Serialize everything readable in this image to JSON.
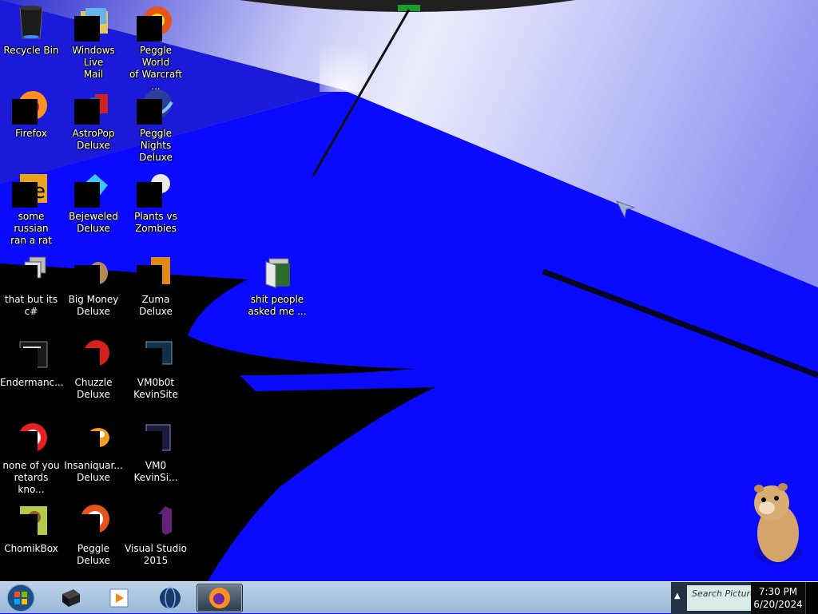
{
  "desktop": {
    "icons": [
      {
        "label": "Recycle Bin",
        "icon": "recycle-bin-icon"
      },
      {
        "label": "Windows Live\nMail",
        "icon": "mail-icon"
      },
      {
        "label": "Peggle World\nof Warcraft ...",
        "icon": "peggle-wow-icon"
      },
      {
        "label": "Firefox",
        "icon": "firefox-icon"
      },
      {
        "label": "AstroPop\nDeluxe",
        "icon": "astropop-icon"
      },
      {
        "label": "Peggle Nights\nDeluxe",
        "icon": "peggle-nights-icon"
      },
      {
        "label": "some russian\nran a rat",
        "icon": "app-icon"
      },
      {
        "label": "Bejeweled\nDeluxe",
        "icon": "bejeweled-icon"
      },
      {
        "label": "Plants vs\nZombies",
        "icon": "plants-vs-zombies-icon"
      },
      {
        "label": "that but its c#",
        "icon": "app-icon"
      },
      {
        "label": "Big Money\nDeluxe",
        "icon": "big-money-icon"
      },
      {
        "label": "Zuma Deluxe",
        "icon": "zuma-icon"
      },
      {
        "label": "Endermanc...",
        "icon": "terminal-icon"
      },
      {
        "label": "Chuzzle\nDeluxe",
        "icon": "chuzzle-icon"
      },
      {
        "label": "VM0b0t\nKevinSite",
        "icon": "vm-icon"
      },
      {
        "label": "none of you\nretards kno...",
        "icon": "app-icon"
      },
      {
        "label": "Insaniquar...\nDeluxe",
        "icon": "insaniquarium-icon"
      },
      {
        "label": "VM0\nKevinSi...",
        "icon": "vm-icon"
      },
      {
        "label": "ChomikBox",
        "icon": "chomikbox-icon"
      },
      {
        "label": "Peggle Deluxe",
        "icon": "peggle-icon"
      },
      {
        "label": "Visual Studio\n2015",
        "icon": "visual-studio-icon"
      },
      {
        "label": "shit people\nasked me ...",
        "icon": "folder-icon"
      }
    ]
  },
  "taskbar": {
    "start": "start-orb-icon",
    "pinned": [
      "media-player-icon",
      "windows-media-center-icon",
      "globe-icon",
      "firefox-icon"
    ],
    "tray": {
      "search_text": "Search Pictures"
    },
    "clock": {
      "time": "7:30 PM",
      "date": "6/20/2024"
    }
  }
}
